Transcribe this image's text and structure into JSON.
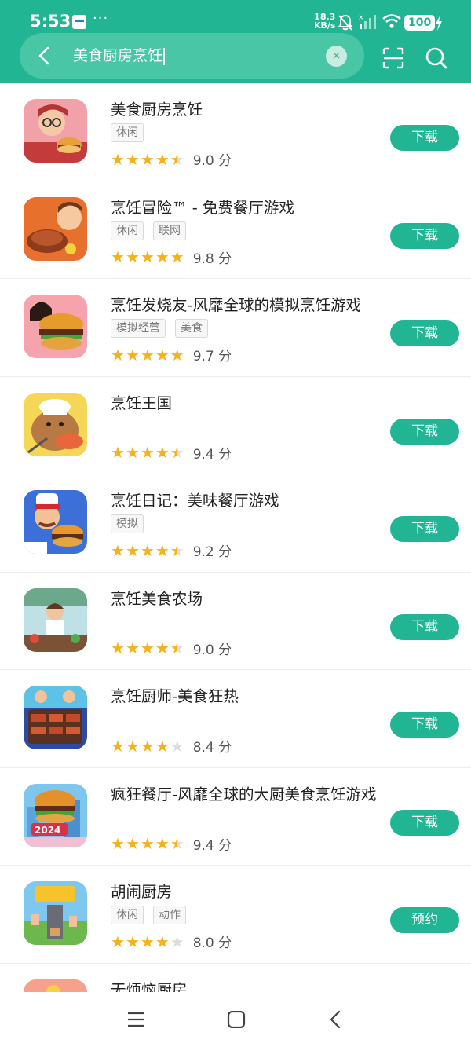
{
  "status": {
    "time": "5:53",
    "speed_value": "18.3",
    "speed_unit": "KB/s",
    "battery": "100",
    "dots": "···"
  },
  "search": {
    "query": "美食厨房烹饪",
    "clear": "×"
  },
  "apps": [
    {
      "title": "美食厨房烹饪",
      "tags": [
        "休闲"
      ],
      "stars": [
        1,
        1,
        1,
        1,
        0.5
      ],
      "score": "9.0 分",
      "button": "下载",
      "thumb": "chef-girl"
    },
    {
      "title": "烹饪冒险™ - 免费餐厅游戏",
      "tags": [
        "休闲",
        "联网"
      ],
      "stars": [
        1,
        1,
        1,
        1,
        1
      ],
      "score": "9.8 分",
      "button": "下载",
      "thumb": "roast"
    },
    {
      "title": "烹饪发烧友-风靡全球的模拟烹饪游戏",
      "tags": [
        "模拟经营",
        "美食"
      ],
      "stars": [
        1,
        1,
        1,
        1,
        1
      ],
      "score": "9.7 分",
      "button": "下载",
      "thumb": "burger-girl"
    },
    {
      "title": "烹饪王国",
      "tags": [],
      "stars": [
        1,
        1,
        1,
        1,
        0.5
      ],
      "score": "9.4 分",
      "button": "下载",
      "thumb": "capybara"
    },
    {
      "title": "烹饪日记：美味餐厅游戏",
      "tags": [
        "模拟"
      ],
      "stars": [
        1,
        1,
        1,
        1,
        0.5
      ],
      "score": "9.2 分",
      "button": "下载",
      "thumb": "chef-man"
    },
    {
      "title": "烹饪美食农场",
      "tags": [],
      "stars": [
        1,
        1,
        1,
        1,
        0.5
      ],
      "score": "9.0 分",
      "button": "下载",
      "thumb": "kitchen"
    },
    {
      "title": "烹饪厨师-美食狂热",
      "tags": [],
      "stars": [
        1,
        1,
        1,
        1,
        0
      ],
      "score": "8.4 分",
      "button": "下载",
      "thumb": "grill"
    },
    {
      "title": "疯狂餐厅-风靡全球的大厨美食烹饪游戏",
      "tags": [],
      "stars": [
        1,
        1,
        1,
        1,
        0.5
      ],
      "score": "9.4 分",
      "button": "下载",
      "thumb": "burger-2024",
      "thumb_text": "2024"
    },
    {
      "title": "胡闹厨房",
      "tags": [
        "休闲",
        "动作"
      ],
      "stars": [
        1,
        1,
        1,
        1,
        0
      ],
      "score": "8.0 分",
      "button": "预约",
      "thumb": "moving-out"
    },
    {
      "title": "无烦恼厨房",
      "tags": [],
      "stars": [],
      "score": "",
      "button": "",
      "thumb": "partial"
    }
  ]
}
